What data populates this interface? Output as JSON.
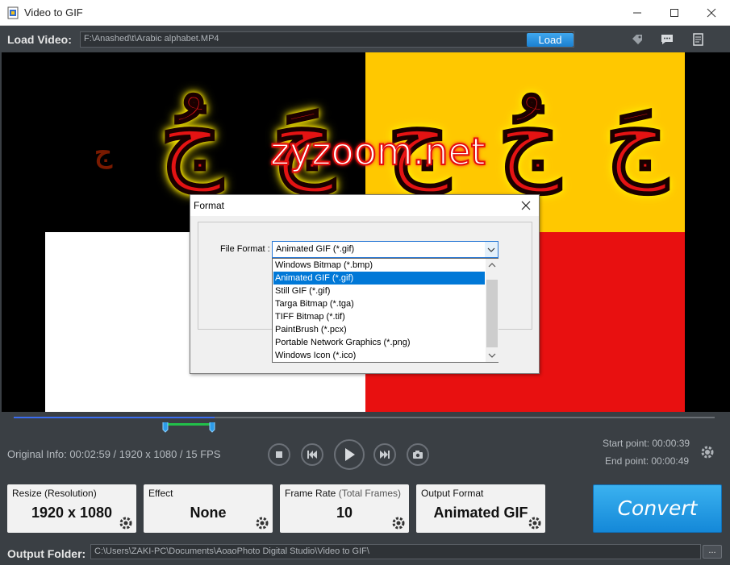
{
  "window": {
    "title": "Video to GIF"
  },
  "load": {
    "label": "Load Video:",
    "path": "F:\\Anashed\\t\\Arabic alphabet.MP4",
    "button": "Load"
  },
  "video": {
    "watermark": "zyzoom.net",
    "glyphs": [
      "ج",
      "جُ",
      "جَ",
      "جِ",
      "جُ",
      "جَ"
    ]
  },
  "dialog": {
    "title": "Format",
    "file_format_label": "File Format :",
    "selected": "Animated GIF (*.gif)",
    "options": [
      "Windows Bitmap (*.bmp)",
      "Animated GIF (*.gif)",
      "Still GIF (*.gif)",
      "Targa Bitmap (*.tga)",
      "TIFF Bitmap (*.tif)",
      "PaintBrush (*.pcx)",
      "Portable Network Graphics (*.png)",
      "Windows Icon (*.ico)"
    ]
  },
  "timeline": {
    "played_fraction": 0.287
  },
  "info": {
    "original": "Original Info: 00:02:59 / 1920 x 1080 / 15 FPS",
    "start": "Start point: 00:00:39",
    "end": "End point: 00:00:49"
  },
  "cards": {
    "resize": {
      "title": "Resize (Resolution)",
      "value": "1920 x 1080"
    },
    "effect": {
      "title": "Effect",
      "value": "None"
    },
    "framerate": {
      "title": "Frame Rate",
      "title_sub": "(Total Frames)",
      "value": "10"
    },
    "output": {
      "title": "Output Format",
      "value": "Animated GIF"
    }
  },
  "convert": {
    "label": "Convert"
  },
  "output_folder": {
    "label": "Output Folder:",
    "path": "C:\\Users\\ZAKI-PC\\Documents\\AoaoPhoto Digital Studio\\Video to GIF\\",
    "browse": "..."
  },
  "icons": [
    "app-icon",
    "minimize-icon",
    "maximize-icon",
    "close-icon",
    "tag-icon",
    "chat-icon",
    "list-icon",
    "stop-icon",
    "previous-icon",
    "play-icon",
    "next-icon",
    "snapshot-icon",
    "gear-icon",
    "chevron-down-icon"
  ],
  "colors": {
    "accent": "#1b7fd0",
    "selection": "#0078d7",
    "range": "#22c04a",
    "played": "#3a6cf0"
  }
}
